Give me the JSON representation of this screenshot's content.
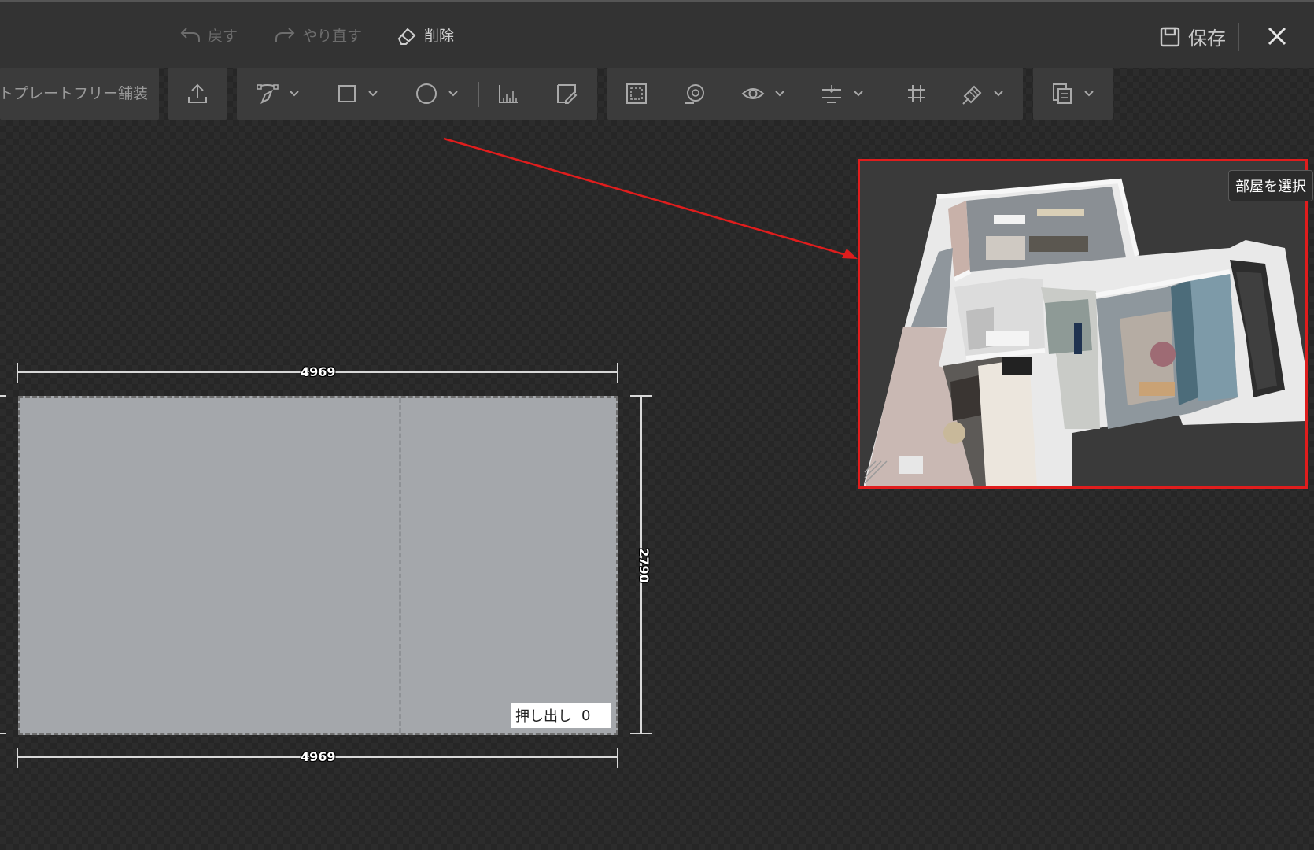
{
  "header": {
    "undo_label": "戻す",
    "redo_label": "やり直す",
    "delete_label": "削除",
    "save_label": "保存"
  },
  "toolbar": {
    "template_label": "トプレートフリー舗装"
  },
  "canvas": {
    "width_top": "4969",
    "width_bottom": "4969",
    "height_right": "2790",
    "extrude_label": "押し出し",
    "extrude_value": "0"
  },
  "preview": {
    "select_room_label": "部屋を選択"
  },
  "colors": {
    "highlight": "#e01d1d",
    "room_fill": "#a4a7ab",
    "toolbar_bg": "#3b3b3b",
    "header_bg": "#333333"
  }
}
